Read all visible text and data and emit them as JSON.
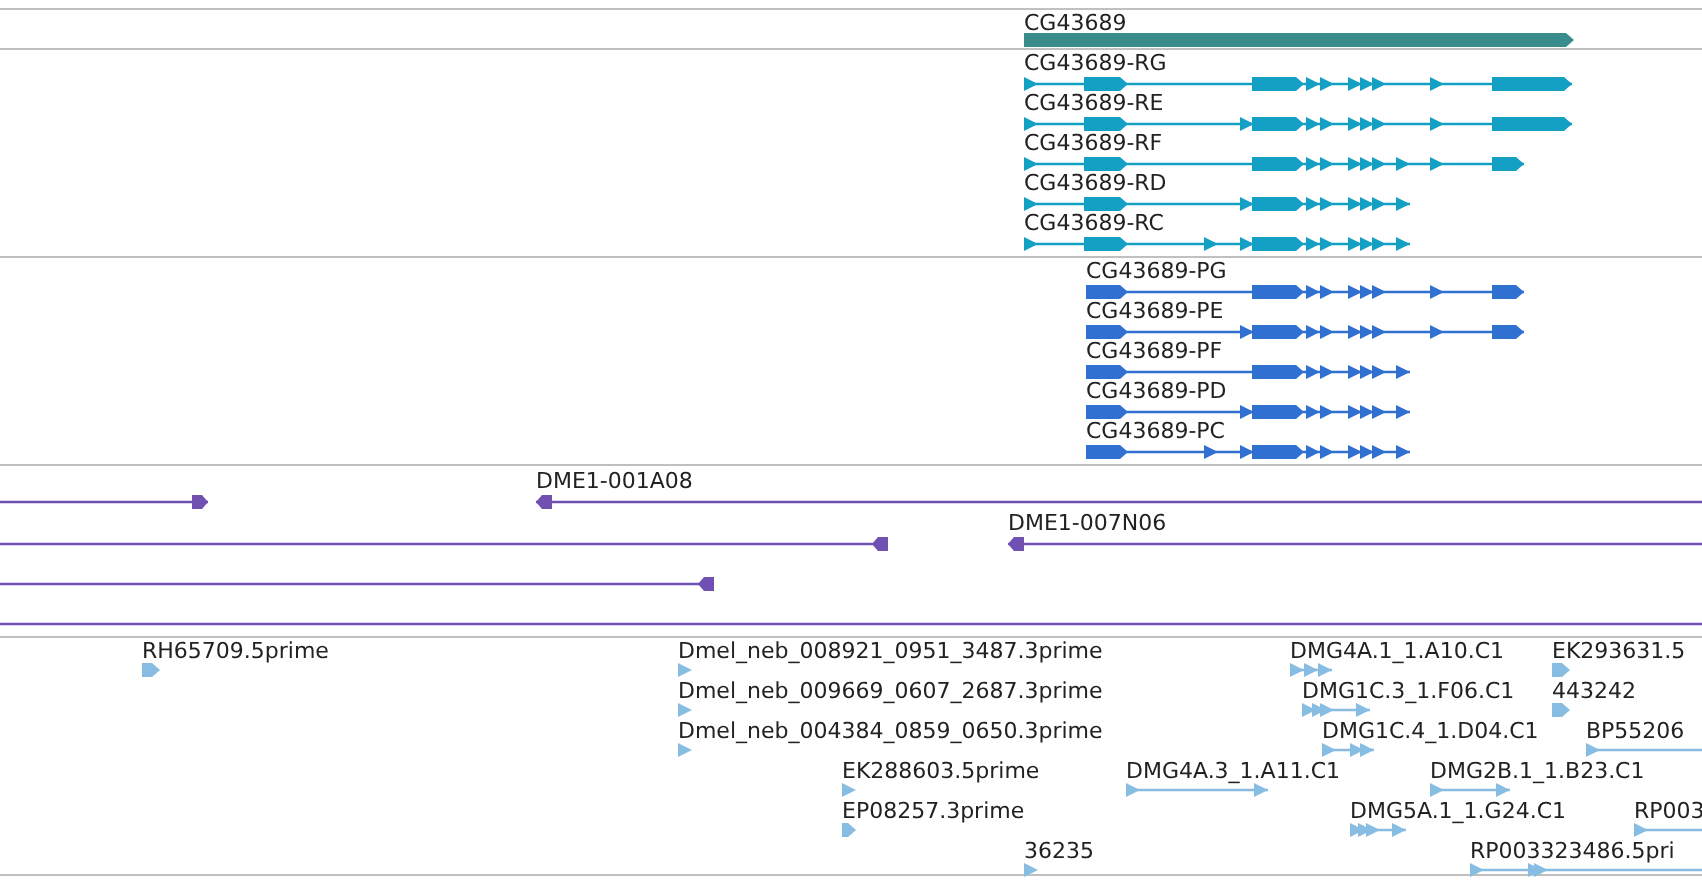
{
  "tracks": [
    {
      "kind": "gene",
      "features": [
        {
          "label": "CG43689"
        }
      ]
    },
    {
      "kind": "transcripts",
      "features": [
        {
          "label": "CG43689-RG"
        },
        {
          "label": "CG43689-RE"
        },
        {
          "label": "CG43689-RF"
        },
        {
          "label": "CG43689-RD"
        },
        {
          "label": "CG43689-RC"
        }
      ]
    },
    {
      "kind": "proteins",
      "features": [
        {
          "label": "CG43689-PG"
        },
        {
          "label": "CG43689-PE"
        },
        {
          "label": "CG43689-PF"
        },
        {
          "label": "CG43689-PD"
        },
        {
          "label": "CG43689-PC"
        }
      ]
    },
    {
      "kind": "clones",
      "rows": [
        {
          "features": [
            {
              "head": true,
              "points_left": false
            },
            {
              "label": "DME1-001A08",
              "head": true,
              "points_left": true
            }
          ]
        },
        {
          "features": [
            {
              "head": true,
              "points_left": true
            },
            {
              "label": "DME1-007N06",
              "head": true,
              "points_left": true
            }
          ]
        },
        {
          "features": [
            {
              "head": true,
              "points_left": true
            }
          ]
        },
        {
          "features": [
            {
              "head": false
            }
          ]
        }
      ]
    },
    {
      "kind": "ests",
      "features": [
        {
          "label": "RH65709.5prime"
        },
        {
          "label": "Dmel_neb_008921_0951_3487.3prime"
        },
        {
          "label": "Dmel_neb_009669_0607_2687.3prime"
        },
        {
          "label": "Dmel_neb_004384_0859_0650.3prime"
        },
        {
          "label": "EK288603.5prime"
        },
        {
          "label": "EP08257.3prime"
        },
        {
          "label": "36235"
        },
        {
          "label": "DMG4A.3_1.A11.C1"
        },
        {
          "label": "DMG4A.1_1.A10.C1"
        },
        {
          "label": "DMG1C.3_1.F06.C1"
        },
        {
          "label": "DMG1C.4_1.D04.C1"
        },
        {
          "label": "DMG2B.1_1.B23.C1"
        },
        {
          "label": "DMG5A.1_1.G24.C1"
        },
        {
          "label": "EK293631.5"
        },
        {
          "label": "443242"
        },
        {
          "label": "BP55206"
        },
        {
          "label": "RP003"
        },
        {
          "label": "RP003323486.5pri"
        }
      ]
    }
  ]
}
